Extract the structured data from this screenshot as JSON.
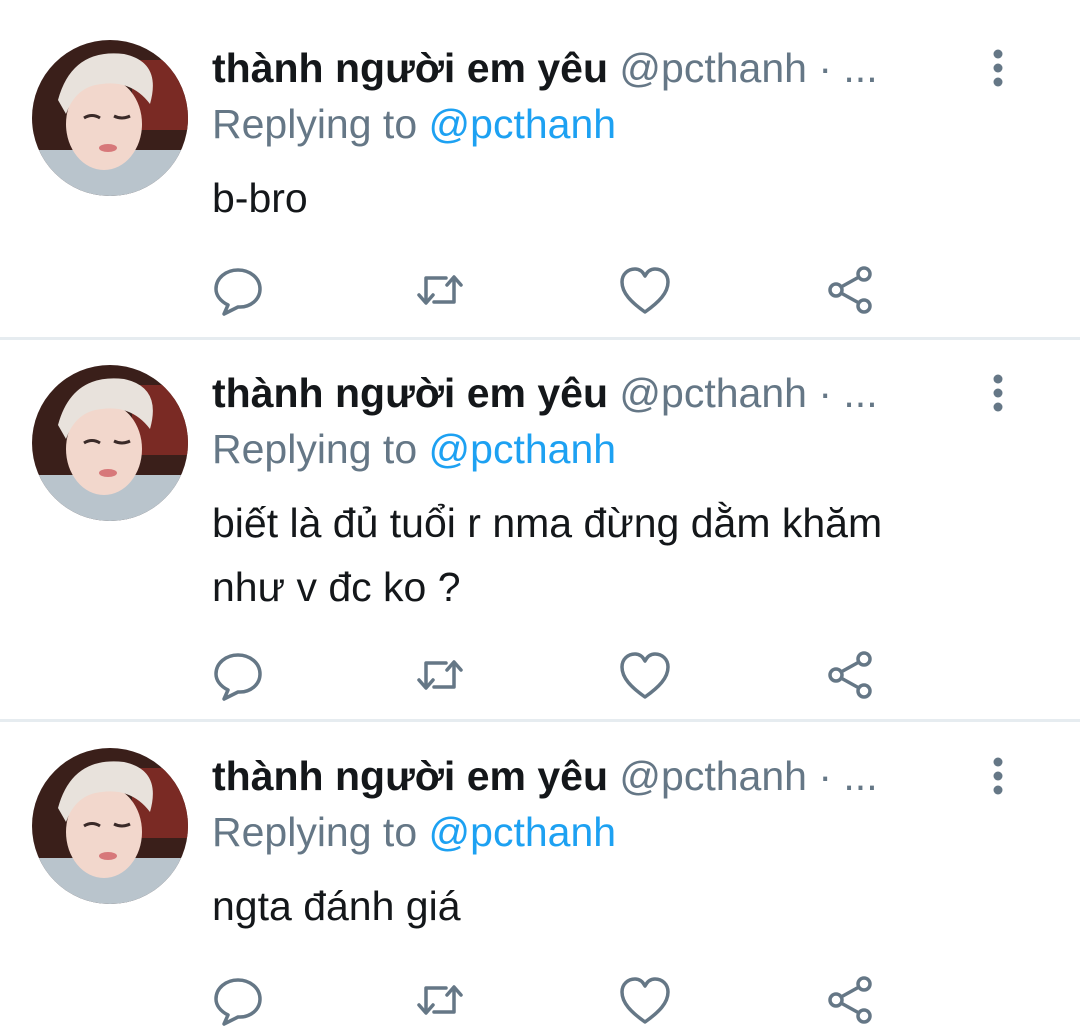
{
  "tweets": [
    {
      "display_name": "thành người em yêu",
      "handle": "@pcthanh",
      "separator": "·",
      "ellipsis": "...",
      "replying_prefix": "Replying to",
      "replying_handle": "@pcthanh",
      "text": "b-bro"
    },
    {
      "display_name": "thành người em yêu",
      "handle": "@pcthanh",
      "separator": "·",
      "ellipsis": "...",
      "replying_prefix": "Replying to",
      "replying_handle": "@pcthanh",
      "text_line1": "biết là đủ tuổi r nma đừng dằm khăm",
      "text_line2": "như v đc ko ?"
    },
    {
      "display_name": "thành người em yêu",
      "handle": "@pcthanh",
      "separator": "·",
      "ellipsis": "...",
      "replying_prefix": "Replying to",
      "replying_handle": "@pcthanh",
      "text": "ngta đánh giá"
    }
  ],
  "icons": {
    "reply": "reply-icon",
    "retweet": "retweet-icon",
    "like": "heart-icon",
    "share": "share-icon",
    "more": "more-vertical-icon"
  },
  "colors": {
    "text": "#14171a",
    "muted": "#657786",
    "link": "#1da1f2",
    "divider": "#e6ecf0"
  }
}
